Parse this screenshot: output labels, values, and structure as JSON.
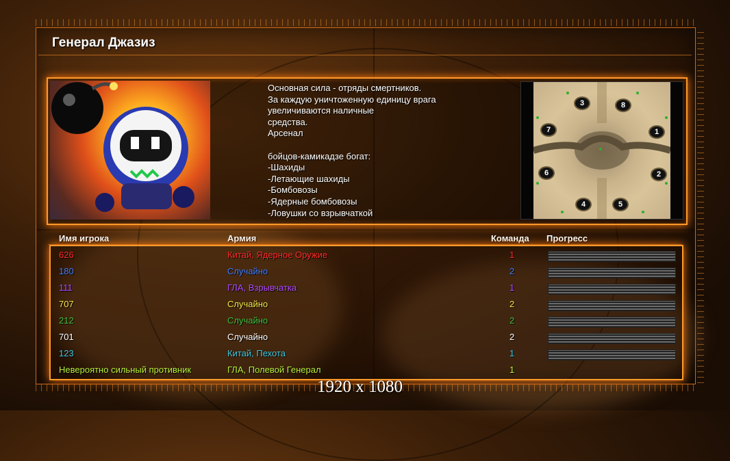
{
  "general": {
    "title": "Генерал Джазиз"
  },
  "description": {
    "text": "Основная сила - отряды смертников.\nЗа каждую уничтоженную единицу врага\n увеличиваются наличные\nсредства.\nАрсенал\n\nбойцов-камикадзе богат:\n-Шахиды\n-Летающие шахиды\n-Бомбовозы\n-Ядерные бомбовозы\n-Ловушки со взрывчаткой"
  },
  "portrait": {
    "icon": "bomberman-portrait"
  },
  "minimap": {
    "slots": [
      "3",
      "8",
      "7",
      "1",
      "6",
      "2",
      "4",
      "5"
    ]
  },
  "columns": {
    "name": "Имя игрока",
    "army": "Армия",
    "team": "Команда",
    "progress": "Прогресс"
  },
  "players": [
    {
      "name": "626",
      "army": "Китай, Ядерное Оружие",
      "team": "1",
      "color": "#ff2a2a",
      "progress": 0
    },
    {
      "name": "180",
      "army": "Случайно",
      "team": "2",
      "color": "#3f7cff",
      "progress": 0
    },
    {
      "name": "111",
      "army": "ГЛА, Взрывчатка",
      "team": "1",
      "color": "#b04aff",
      "progress": 0
    },
    {
      "name": "707",
      "army": "Случайно",
      "team": "2",
      "color": "#f2e64a",
      "progress": 0
    },
    {
      "name": "212",
      "army": "Случайно",
      "team": "2",
      "color": "#3fbf3f",
      "progress": 0
    },
    {
      "name": "701",
      "army": "Случайно",
      "team": "2",
      "color": "#ffffff",
      "progress": 0
    },
    {
      "name": "123",
      "army": "Китай, Пехота",
      "team": "1",
      "color": "#3fc8e0",
      "progress": 0
    },
    {
      "name": "Невероятно сильный противник",
      "army": "ГЛА, Полевой Генерал",
      "team": "1",
      "color": "#b8f23a",
      "progress": null
    }
  ],
  "resolution_label": "1920 x 1080"
}
